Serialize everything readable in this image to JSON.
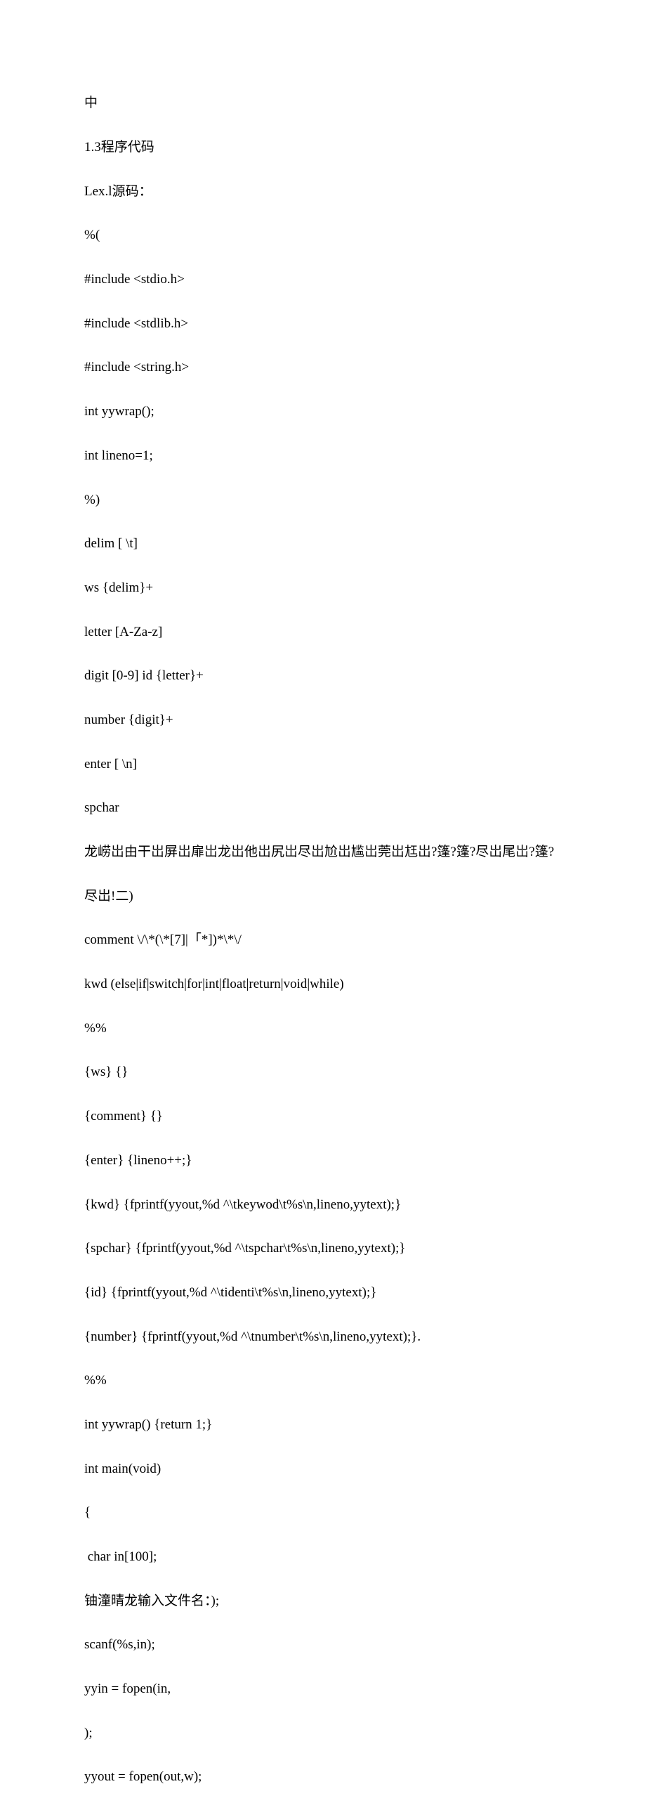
{
  "doc": {
    "lines": [
      "中",
      "1.3程序代码",
      "Lex.l源码：",
      "%(",
      "#include <stdio.h>",
      "#include <stdlib.h>",
      "#include <string.h>",
      "int yywrap();",
      "int lineno=1;",
      "%)",
      "delim [ \\t]",
      "ws {delim}+",
      "letter [A-Za-z]",
      "digit [0-9] id {letter}+",
      "number {digit}+",
      "enter [ \\n]",
      "spchar",
      "龙崂岀由干岀屏岀扉岀龙岀他岀尻岀尽岀尬岀尴岀莞岀尪岀?篷?篷?尽岀尾岀?篷?",
      "尽岀!二)",
      "comment \\/\\*(\\*[7]|「*])*\\*\\/",
      "kwd (else|if|switch|for|int|float|return|void|while)",
      "%%",
      "{ws} {}",
      "{comment} {}",
      "{enter} {lineno++;}",
      "{kwd} {fprintf(yyout,%d ^\\tkeywod\\t%s\\n,lineno,yytext);}",
      "{spchar} {fprintf(yyout,%d ^\\tspchar\\t%s\\n,lineno,yytext);}",
      "{id} {fprintf(yyout,%d ^\\tidenti\\t%s\\n,lineno,yytext);}",
      "{number} {fprintf(yyout,%d ^\\tnumber\\t%s\\n,lineno,yytext);}.",
      "%%",
      "int yywrap() {return 1;}",
      "int main(void)",
      "{",
      " char in[100];",
      "铀潼晴龙输入文件名：);",
      "scanf(%s,in);",
      "yyin = fopen(in,",
      ");",
      "yyout = fopen(out,w);"
    ]
  }
}
